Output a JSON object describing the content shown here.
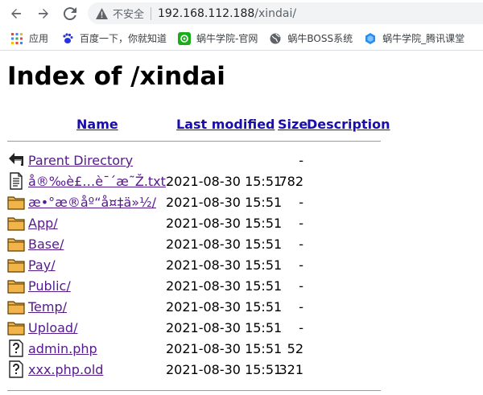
{
  "browser": {
    "security_label": "不安全",
    "url_host": "192.168.112.188",
    "url_path": "/xindai/",
    "back_icon": "arrow-left-icon",
    "forward_icon": "arrow-right-icon",
    "reload_icon": "reload-icon",
    "warning_icon": "warning-triangle-icon"
  },
  "bookmarks": [
    {
      "label": "应用",
      "icon": "apps-grid-icon",
      "color": "#4285f4"
    },
    {
      "label": "百度一下，你就知道",
      "icon": "baidu-paw-icon",
      "color": "#2932e1"
    },
    {
      "label": "蜗牛学院-官网",
      "icon": "snail-green-icon",
      "color": "#1aad19"
    },
    {
      "label": "蜗牛BOSS系统",
      "icon": "globe-icon",
      "color": "#5f6368"
    },
    {
      "label": "蜗牛学院_腾讯课堂",
      "icon": "tencent-class-icon",
      "color": "#2a8cf0"
    }
  ],
  "page": {
    "title": "Index of /xindai",
    "columns": {
      "name": "Name",
      "last_modified": "Last modified",
      "size": "Size",
      "description": "Description"
    },
    "rows": [
      {
        "icon": "back-arrow-icon",
        "name": "Parent Directory",
        "date": "",
        "size": "-"
      },
      {
        "icon": "text-file-icon",
        "name": "å®‰è£…è¯´æ˜Ž.txt",
        "date": "2021-08-30 15:51",
        "size": "782"
      },
      {
        "icon": "folder-icon",
        "name": "æ•°æ®åº“å¤‡ä»½/",
        "date": "2021-08-30 15:51",
        "size": "-"
      },
      {
        "icon": "folder-icon",
        "name": "App/",
        "date": "2021-08-30 15:51",
        "size": "-"
      },
      {
        "icon": "folder-icon",
        "name": "Base/",
        "date": "2021-08-30 15:51",
        "size": "-"
      },
      {
        "icon": "folder-icon",
        "name": "Pay/",
        "date": "2021-08-30 15:51",
        "size": "-"
      },
      {
        "icon": "folder-icon",
        "name": "Public/",
        "date": "2021-08-30 15:51",
        "size": "-"
      },
      {
        "icon": "folder-icon",
        "name": "Temp/",
        "date": "2021-08-30 15:51",
        "size": "-"
      },
      {
        "icon": "folder-icon",
        "name": "Upload/",
        "date": "2021-08-30 15:51",
        "size": "-"
      },
      {
        "icon": "unknown-file-icon",
        "name": "admin.php",
        "date": "2021-08-30 15:51",
        "size": "52"
      },
      {
        "icon": "unknown-file-icon",
        "name": "xxx.php.old",
        "date": "2021-08-30 15:51",
        "size": "321"
      }
    ]
  }
}
